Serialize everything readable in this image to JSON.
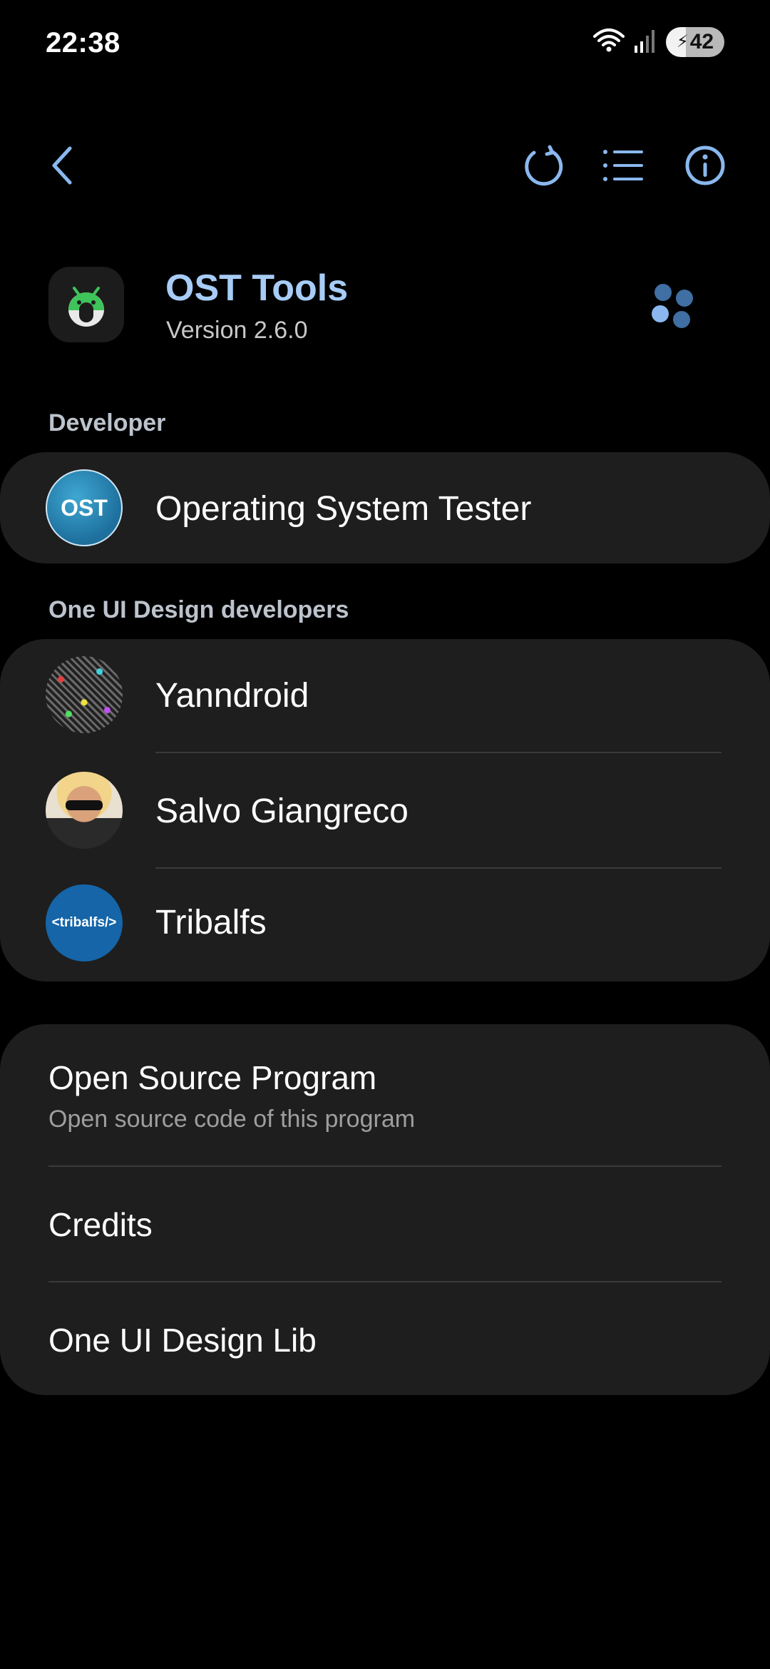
{
  "status_bar": {
    "time": "22:38",
    "battery": "42"
  },
  "toolbar": {
    "back_icon": "back-arrow-icon",
    "icons": [
      "refresh-icon",
      "list-icon",
      "info-icon"
    ]
  },
  "app": {
    "name": "OST Tools",
    "version": "Version 2.6.0"
  },
  "developer_section": {
    "title": "Developer",
    "developer": {
      "name": "Operating System Tester",
      "avatar_text": "OST"
    }
  },
  "design_section": {
    "title": "One UI Design developers",
    "items": [
      {
        "name": "Yanndroid"
      },
      {
        "name": "Salvo Giangreco"
      },
      {
        "name": "Tribalfs",
        "avatar_text": "<tribalfs/>"
      }
    ]
  },
  "links": {
    "items": [
      {
        "title": "Open Source Program",
        "subtitle": "Open source code of this program"
      },
      {
        "title": "Credits"
      },
      {
        "title": "One UI Design Lib"
      }
    ]
  },
  "colors": {
    "accent": "#a7ccf6",
    "icon_blue": "#8ab8ee",
    "card": "#1e1e1e",
    "background": "#000000"
  }
}
